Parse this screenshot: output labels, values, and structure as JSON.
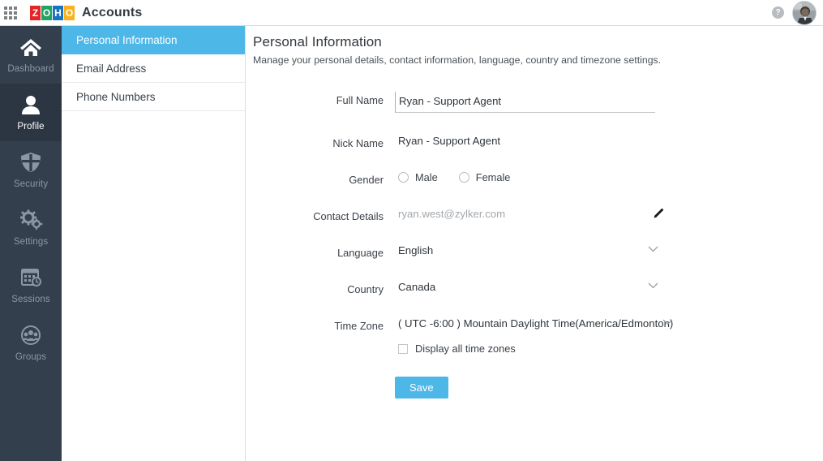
{
  "header": {
    "apps_icon": "grid-apps-icon",
    "brand_logo_letters": [
      "Z",
      "O",
      "H",
      "O"
    ],
    "brand_name": "Accounts",
    "help_icon": "help-question-icon",
    "help_label": "?",
    "avatar_icon": "user-avatar"
  },
  "rail": {
    "items": [
      {
        "label": "Dashboard",
        "icon": "home-icon",
        "active": false
      },
      {
        "label": "Profile",
        "icon": "person-icon",
        "active": true
      },
      {
        "label": "Security",
        "icon": "shield-icon",
        "active": false
      },
      {
        "label": "Settings",
        "icon": "gears-icon",
        "active": false
      },
      {
        "label": "Sessions",
        "icon": "calendar-clock-icon",
        "active": false
      },
      {
        "label": "Groups",
        "icon": "people-circle-icon",
        "active": false
      }
    ]
  },
  "subnav": {
    "items": [
      {
        "label": "Personal Information",
        "active": true
      },
      {
        "label": "Email Address",
        "active": false
      },
      {
        "label": "Phone Numbers",
        "active": false
      }
    ]
  },
  "main": {
    "title": "Personal Information",
    "subtitle": "Manage your personal details, contact information, language, country and timezone settings.",
    "fields": {
      "full_name": {
        "label": "Full Name",
        "value": "Ryan - Support Agent",
        "placeholder": "Full Name"
      },
      "nick_name": {
        "label": "Nick Name",
        "value": "Ryan - Support Agent"
      },
      "gender": {
        "label": "Gender",
        "options": [
          {
            "label": "Male",
            "selected": false
          },
          {
            "label": "Female",
            "selected": false
          }
        ]
      },
      "contact_details": {
        "label": "Contact Details",
        "value": "ryan.west@zylker.com",
        "edit_icon": "pencil-edit-icon"
      },
      "language": {
        "label": "Language",
        "value": "English",
        "chevron": "chevron-down-icon"
      },
      "country": {
        "label": "Country",
        "value": "Canada",
        "chevron": "chevron-down-icon"
      },
      "time_zone": {
        "label": "Time Zone",
        "value": "( UTC -6:00 ) Mountain Daylight Time(America/Edmonton)",
        "chevron": "chevron-down-icon",
        "checkbox_label": "Display all time zones",
        "checkbox_checked": false
      }
    },
    "save_label": "Save"
  },
  "colors": {
    "accent_blue": "#4db7e8",
    "rail_bg": "#343f4d",
    "rail_active_bg": "#2c3643",
    "text_dark": "#33383d",
    "muted_text": "#a3a8ac"
  }
}
